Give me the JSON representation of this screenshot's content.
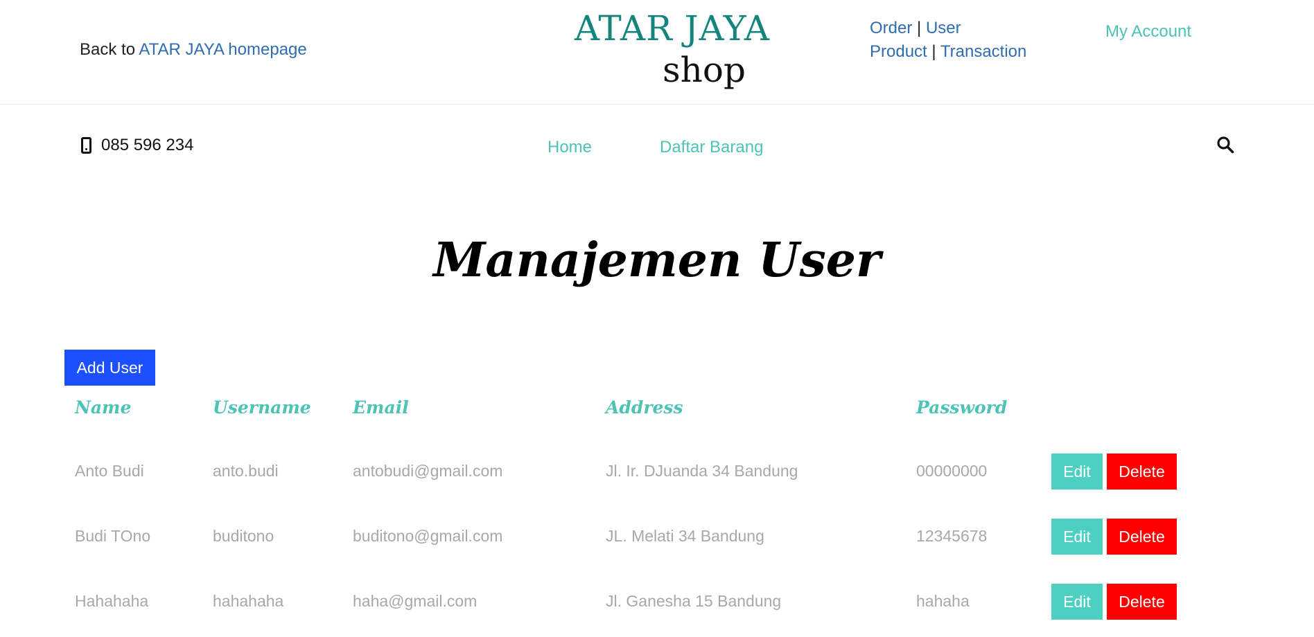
{
  "header": {
    "back_prefix": "Back to",
    "back_link": "ATAR JAYA homepage",
    "logo_top": "ATAR JAYA",
    "logo_bottom": "shop",
    "admin_links": {
      "order": "Order",
      "separator": "|",
      "user": "User",
      "product": "Product",
      "transaction": "Transaction"
    },
    "my_account": "My Account"
  },
  "navbar": {
    "phone": "085 596 234",
    "links": [
      "Home",
      "Daftar Barang"
    ]
  },
  "page": {
    "title": "Manajemen User",
    "add_button": "Add User"
  },
  "table": {
    "headers": [
      "Name",
      "Username",
      "Email",
      "Address",
      "Password"
    ],
    "rows": [
      {
        "name": "Anto Budi",
        "username": "anto.budi",
        "email": "antobudi@gmail.com",
        "address": "Jl. Ir. DJuanda 34 Bandung",
        "password": "00000000"
      },
      {
        "name": "Budi TOno",
        "username": "buditono",
        "email": "buditono@gmail.com",
        "address": "JL. Melati 34 Bandung",
        "password": "12345678"
      },
      {
        "name": "Hahahaha",
        "username": "hahahaha",
        "email": "haha@gmail.com",
        "address": "Jl. Ganesha 15 Bandung",
        "password": "hahaha"
      }
    ],
    "edit_label": "Edit",
    "delete_label": "Delete"
  },
  "colors": {
    "accent_teal": "#4dc3b6",
    "link_blue": "#2f6db0",
    "add_button": "#1c4fff",
    "delete_button": "#ff0000",
    "logo_teal": "#13857c"
  },
  "icons": {
    "phone": "mobile-phone-icon",
    "search": "search-icon"
  }
}
